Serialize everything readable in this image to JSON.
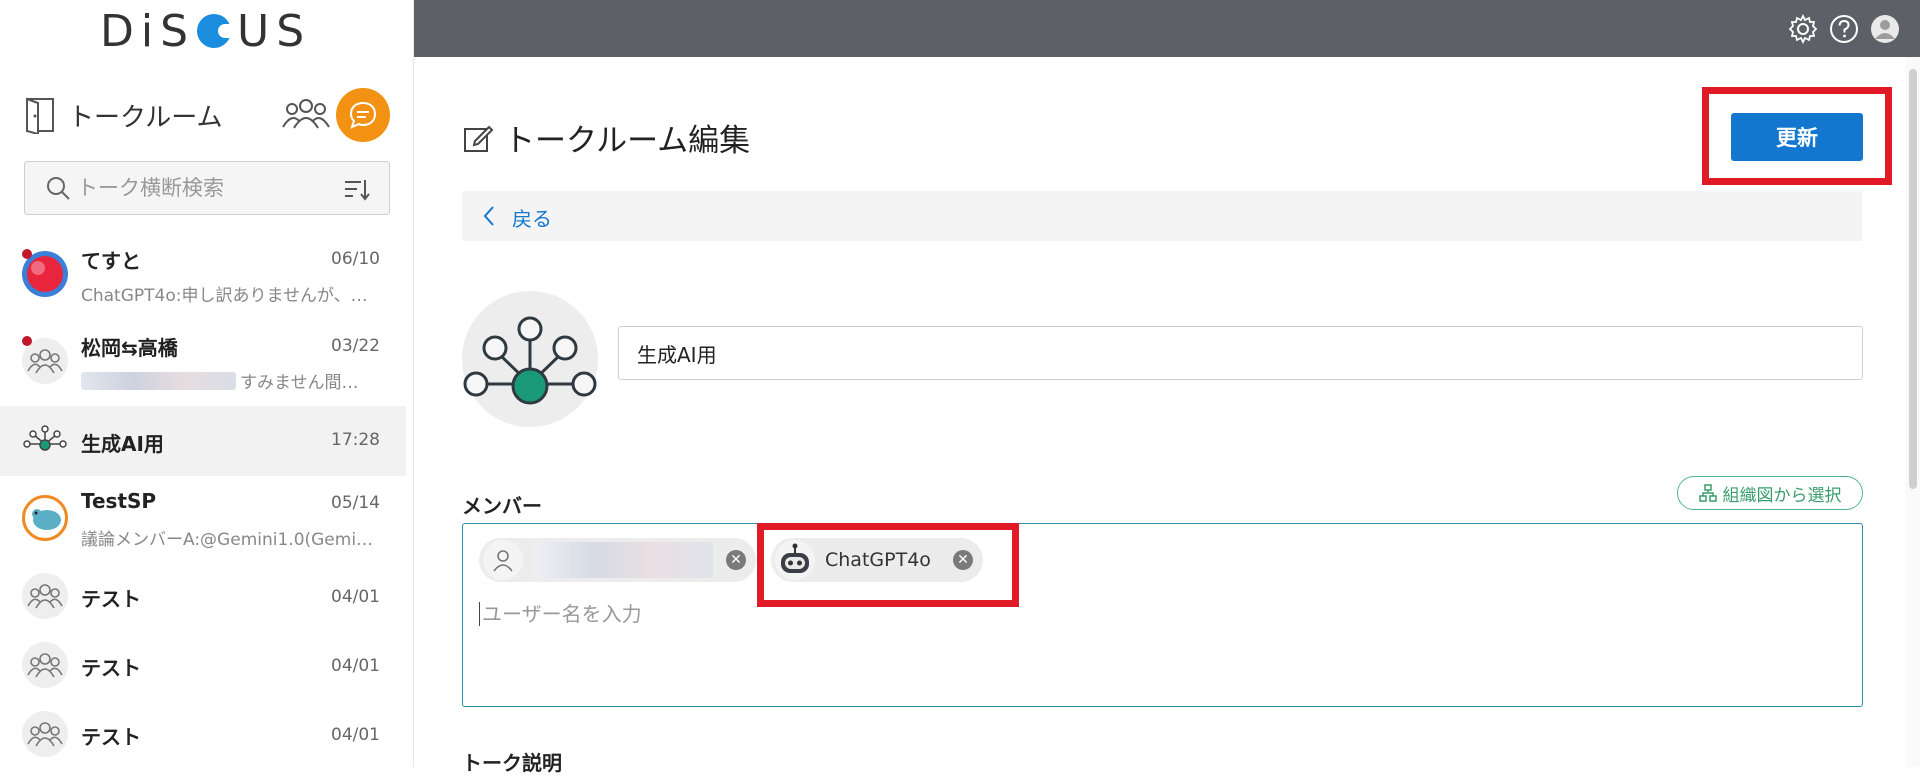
{
  "app": {
    "logo_text": "DiSCUS"
  },
  "sidebar": {
    "header_title": "トークルーム",
    "search_placeholder": "トーク横断検索",
    "rooms": [
      {
        "name": "てすと",
        "date": "06/10",
        "preview": "ChatGPT4o:申し訳ありませんが、…",
        "unread": true,
        "avatar": "red-circle"
      },
      {
        "name": "松岡⇆高橋",
        "date": "03/22",
        "preview": "すみません間…",
        "unread": true,
        "avatar": "group"
      },
      {
        "name": "生成AI用",
        "date": "17:28",
        "preview": "",
        "unread": false,
        "avatar": "network",
        "active": true
      },
      {
        "name": "TestSP",
        "date": "05/14",
        "preview": "議論メンバーA:@Gemini1.0(Gemi…",
        "unread": false,
        "avatar": "bird"
      },
      {
        "name": "テスト",
        "date": "04/01",
        "preview": "",
        "unread": false,
        "avatar": "group"
      },
      {
        "name": "テスト",
        "date": "04/01",
        "preview": "",
        "unread": false,
        "avatar": "group"
      },
      {
        "name": "テスト",
        "date": "04/01",
        "preview": "",
        "unread": false,
        "avatar": "group"
      }
    ]
  },
  "topbar": {
    "icons": [
      "gear-icon",
      "help-icon",
      "user-icon"
    ]
  },
  "main": {
    "title": "トークルーム編集",
    "update_label": "更新",
    "back_label": "戻る",
    "room_name_value": "生成AI用",
    "member_label": "メンバー",
    "org_select_label": "組織図から選択",
    "members": [
      {
        "name": "",
        "type": "user"
      },
      {
        "name": "ChatGPT4o",
        "type": "bot"
      }
    ],
    "member_input_placeholder": "ユーザー名を入力",
    "description_label": "トーク説明"
  },
  "colors": {
    "accent": "#1477cf",
    "orange": "#f39212",
    "topbar": "#5e6068",
    "highlight": "#e01a26",
    "green": "#3a9e6c"
  }
}
